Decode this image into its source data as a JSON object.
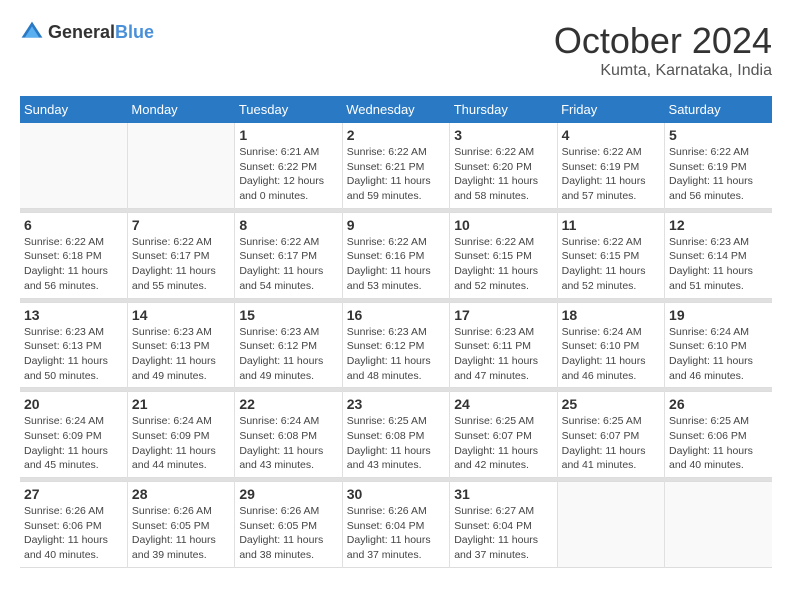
{
  "logo": {
    "text_general": "General",
    "text_blue": "Blue"
  },
  "title": "October 2024",
  "location": "Kumta, Karnataka, India",
  "days_of_week": [
    "Sunday",
    "Monday",
    "Tuesday",
    "Wednesday",
    "Thursday",
    "Friday",
    "Saturday"
  ],
  "weeks": [
    [
      {
        "day": "",
        "sunrise": "",
        "sunset": "",
        "daylight": ""
      },
      {
        "day": "",
        "sunrise": "",
        "sunset": "",
        "daylight": ""
      },
      {
        "day": "1",
        "sunrise": "Sunrise: 6:21 AM",
        "sunset": "Sunset: 6:22 PM",
        "daylight": "Daylight: 12 hours and 0 minutes."
      },
      {
        "day": "2",
        "sunrise": "Sunrise: 6:22 AM",
        "sunset": "Sunset: 6:21 PM",
        "daylight": "Daylight: 11 hours and 59 minutes."
      },
      {
        "day": "3",
        "sunrise": "Sunrise: 6:22 AM",
        "sunset": "Sunset: 6:20 PM",
        "daylight": "Daylight: 11 hours and 58 minutes."
      },
      {
        "day": "4",
        "sunrise": "Sunrise: 6:22 AM",
        "sunset": "Sunset: 6:19 PM",
        "daylight": "Daylight: 11 hours and 57 minutes."
      },
      {
        "day": "5",
        "sunrise": "Sunrise: 6:22 AM",
        "sunset": "Sunset: 6:19 PM",
        "daylight": "Daylight: 11 hours and 56 minutes."
      }
    ],
    [
      {
        "day": "6",
        "sunrise": "Sunrise: 6:22 AM",
        "sunset": "Sunset: 6:18 PM",
        "daylight": "Daylight: 11 hours and 56 minutes."
      },
      {
        "day": "7",
        "sunrise": "Sunrise: 6:22 AM",
        "sunset": "Sunset: 6:17 PM",
        "daylight": "Daylight: 11 hours and 55 minutes."
      },
      {
        "day": "8",
        "sunrise": "Sunrise: 6:22 AM",
        "sunset": "Sunset: 6:17 PM",
        "daylight": "Daylight: 11 hours and 54 minutes."
      },
      {
        "day": "9",
        "sunrise": "Sunrise: 6:22 AM",
        "sunset": "Sunset: 6:16 PM",
        "daylight": "Daylight: 11 hours and 53 minutes."
      },
      {
        "day": "10",
        "sunrise": "Sunrise: 6:22 AM",
        "sunset": "Sunset: 6:15 PM",
        "daylight": "Daylight: 11 hours and 52 minutes."
      },
      {
        "day": "11",
        "sunrise": "Sunrise: 6:22 AM",
        "sunset": "Sunset: 6:15 PM",
        "daylight": "Daylight: 11 hours and 52 minutes."
      },
      {
        "day": "12",
        "sunrise": "Sunrise: 6:23 AM",
        "sunset": "Sunset: 6:14 PM",
        "daylight": "Daylight: 11 hours and 51 minutes."
      }
    ],
    [
      {
        "day": "13",
        "sunrise": "Sunrise: 6:23 AM",
        "sunset": "Sunset: 6:13 PM",
        "daylight": "Daylight: 11 hours and 50 minutes."
      },
      {
        "day": "14",
        "sunrise": "Sunrise: 6:23 AM",
        "sunset": "Sunset: 6:13 PM",
        "daylight": "Daylight: 11 hours and 49 minutes."
      },
      {
        "day": "15",
        "sunrise": "Sunrise: 6:23 AM",
        "sunset": "Sunset: 6:12 PM",
        "daylight": "Daylight: 11 hours and 49 minutes."
      },
      {
        "day": "16",
        "sunrise": "Sunrise: 6:23 AM",
        "sunset": "Sunset: 6:12 PM",
        "daylight": "Daylight: 11 hours and 48 minutes."
      },
      {
        "day": "17",
        "sunrise": "Sunrise: 6:23 AM",
        "sunset": "Sunset: 6:11 PM",
        "daylight": "Daylight: 11 hours and 47 minutes."
      },
      {
        "day": "18",
        "sunrise": "Sunrise: 6:24 AM",
        "sunset": "Sunset: 6:10 PM",
        "daylight": "Daylight: 11 hours and 46 minutes."
      },
      {
        "day": "19",
        "sunrise": "Sunrise: 6:24 AM",
        "sunset": "Sunset: 6:10 PM",
        "daylight": "Daylight: 11 hours and 46 minutes."
      }
    ],
    [
      {
        "day": "20",
        "sunrise": "Sunrise: 6:24 AM",
        "sunset": "Sunset: 6:09 PM",
        "daylight": "Daylight: 11 hours and 45 minutes."
      },
      {
        "day": "21",
        "sunrise": "Sunrise: 6:24 AM",
        "sunset": "Sunset: 6:09 PM",
        "daylight": "Daylight: 11 hours and 44 minutes."
      },
      {
        "day": "22",
        "sunrise": "Sunrise: 6:24 AM",
        "sunset": "Sunset: 6:08 PM",
        "daylight": "Daylight: 11 hours and 43 minutes."
      },
      {
        "day": "23",
        "sunrise": "Sunrise: 6:25 AM",
        "sunset": "Sunset: 6:08 PM",
        "daylight": "Daylight: 11 hours and 43 minutes."
      },
      {
        "day": "24",
        "sunrise": "Sunrise: 6:25 AM",
        "sunset": "Sunset: 6:07 PM",
        "daylight": "Daylight: 11 hours and 42 minutes."
      },
      {
        "day": "25",
        "sunrise": "Sunrise: 6:25 AM",
        "sunset": "Sunset: 6:07 PM",
        "daylight": "Daylight: 11 hours and 41 minutes."
      },
      {
        "day": "26",
        "sunrise": "Sunrise: 6:25 AM",
        "sunset": "Sunset: 6:06 PM",
        "daylight": "Daylight: 11 hours and 40 minutes."
      }
    ],
    [
      {
        "day": "27",
        "sunrise": "Sunrise: 6:26 AM",
        "sunset": "Sunset: 6:06 PM",
        "daylight": "Daylight: 11 hours and 40 minutes."
      },
      {
        "day": "28",
        "sunrise": "Sunrise: 6:26 AM",
        "sunset": "Sunset: 6:05 PM",
        "daylight": "Daylight: 11 hours and 39 minutes."
      },
      {
        "day": "29",
        "sunrise": "Sunrise: 6:26 AM",
        "sunset": "Sunset: 6:05 PM",
        "daylight": "Daylight: 11 hours and 38 minutes."
      },
      {
        "day": "30",
        "sunrise": "Sunrise: 6:26 AM",
        "sunset": "Sunset: 6:04 PM",
        "daylight": "Daylight: 11 hours and 37 minutes."
      },
      {
        "day": "31",
        "sunrise": "Sunrise: 6:27 AM",
        "sunset": "Sunset: 6:04 PM",
        "daylight": "Daylight: 11 hours and 37 minutes."
      },
      {
        "day": "",
        "sunrise": "",
        "sunset": "",
        "daylight": ""
      },
      {
        "day": "",
        "sunrise": "",
        "sunset": "",
        "daylight": ""
      }
    ]
  ]
}
